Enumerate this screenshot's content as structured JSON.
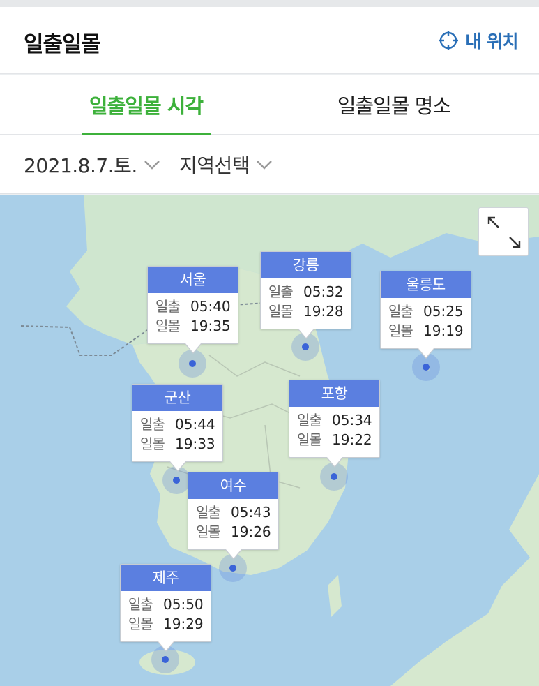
{
  "header": {
    "title": "일출일몰",
    "my_location_label": "내 위치"
  },
  "tabs": [
    {
      "label": "일출일몰 시각",
      "active": true
    },
    {
      "label": "일출일몰 명소",
      "active": false
    }
  ],
  "filters": {
    "date": "2021.8.7.토.",
    "region": "지역선택"
  },
  "labels": {
    "sunrise": "일출",
    "sunset": "일몰"
  },
  "colors": {
    "accent_green": "#3db13b",
    "card_header": "#5b7fe0",
    "link_blue": "#2a6fb7"
  },
  "cities": [
    {
      "name": "서울",
      "sunrise": "05:40",
      "sunset": "19:35"
    },
    {
      "name": "강릉",
      "sunrise": "05:32",
      "sunset": "19:28"
    },
    {
      "name": "울릉도",
      "sunrise": "05:25",
      "sunset": "19:19"
    },
    {
      "name": "군산",
      "sunrise": "05:44",
      "sunset": "19:33"
    },
    {
      "name": "포항",
      "sunrise": "05:34",
      "sunset": "19:22"
    },
    {
      "name": "여수",
      "sunrise": "05:43",
      "sunset": "19:26"
    },
    {
      "name": "제주",
      "sunrise": "05:50",
      "sunset": "19:29"
    }
  ]
}
